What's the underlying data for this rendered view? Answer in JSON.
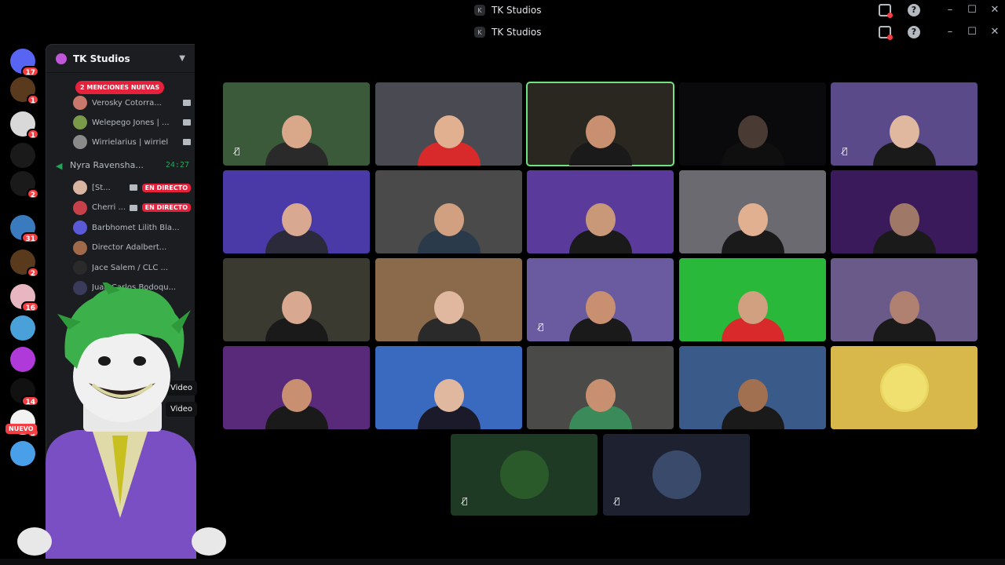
{
  "window": {
    "title": "TK Studios",
    "server_glyph": "K"
  },
  "rail": {
    "servers": [
      {
        "name": "discord-home",
        "badge": "17",
        "color": "#5865f2"
      },
      {
        "name": "server-2",
        "badge": "1",
        "color": "#5a3a1c"
      },
      {
        "name": "server-3",
        "badge": "1",
        "color": "#d9d9d9"
      },
      {
        "name": "server-tk",
        "badge": "",
        "color": "#1a1a1a"
      },
      {
        "name": "server-5",
        "badge": "2",
        "color": "#1a1a1a"
      },
      {
        "name": "server-6",
        "badge": "31",
        "color": "#3a7bbf"
      },
      {
        "name": "server-7",
        "badge": "2",
        "color": "#5a3a1c"
      },
      {
        "name": "server-8",
        "badge": "16",
        "color": "#e8b6c0"
      },
      {
        "name": "server-9",
        "badge": "",
        "color": "#4aa0d8"
      },
      {
        "name": "server-10",
        "badge": "",
        "color": "#b03ad9"
      },
      {
        "name": "server-11",
        "badge": "14",
        "color": "#111"
      },
      {
        "name": "server-12",
        "badge": "5",
        "color": "#f2f2f2"
      },
      {
        "name": "server-13",
        "badge": "",
        "color": "#4aa0e8"
      }
    ],
    "nuevo_label": "NUEVO"
  },
  "panel": {
    "server_name": "TK Studios",
    "mentions_label": "2 MENCIONES NUEVAS",
    "voice_channel": {
      "name": "Nyra Ravensha...",
      "timer": "24:27"
    },
    "users_top": [
      {
        "name": "Verosky Cotorra...",
        "color": "#c8786a"
      },
      {
        "name": "Welepego Jones | ...",
        "color": "#7a9a4a"
      },
      {
        "name": "Wirrielarius | wirriel",
        "color": "#8a8a8a"
      }
    ],
    "users_voice": [
      {
        "name": "[St...",
        "color": "#d9b4a0",
        "live": "EN DIRECTO"
      },
      {
        "name": "Cherri ...",
        "color": "#c8404a",
        "live": "EN DIRECTO"
      },
      {
        "name": "Barbhomet Lilith Bla...",
        "color": "#5a5ad8",
        "live": ""
      },
      {
        "name": "Director Adalbert...",
        "color": "#a06a4a",
        "live": ""
      },
      {
        "name": "Jace Salem / CLC ...",
        "color": "#2a2a2a",
        "live": ""
      },
      {
        "name": "Juan Carlos Bodoqu...",
        "color": "#3a3a5a",
        "live": ""
      }
    ],
    "tooltips": [
      "Video",
      "Video"
    ]
  },
  "grid": {
    "tiles": [
      {
        "bg": "#3a5a3a",
        "skin": "#d9a88a",
        "shirt": "#2a2a2a",
        "mute": true,
        "speaking": false
      },
      {
        "bg": "#4a4a52",
        "skin": "#e0b090",
        "shirt": "#d82a2a",
        "mute": false,
        "speaking": false
      },
      {
        "bg": "#2a2620",
        "skin": "#c89070",
        "shirt": "#1a1a1a",
        "mute": false,
        "speaking": true
      },
      {
        "bg": "#0a0a0c",
        "skin": "#4a3a34",
        "shirt": "#0f0f0f",
        "mute": false,
        "speaking": false
      },
      {
        "bg": "#5a4a8a",
        "skin": "#e0b8a0",
        "shirt": "#1a1a1a",
        "mute": true,
        "speaking": false
      },
      {
        "bg": "#4a3aa8",
        "skin": "#d8a890",
        "shirt": "#2a2a3a",
        "mute": false,
        "speaking": false
      },
      {
        "bg": "#4a4a4a",
        "skin": "#d0a080",
        "shirt": "#2a3a4a",
        "mute": false,
        "speaking": false
      },
      {
        "bg": "#5a3a9a",
        "skin": "#c89878",
        "shirt": "#1a1a1a",
        "mute": false,
        "speaking": false
      },
      {
        "bg": "#6a6a70",
        "skin": "#e0b090",
        "shirt": "#1a1a1a",
        "mute": false,
        "speaking": false
      },
      {
        "bg": "#3a1a5a",
        "skin": "#a07868",
        "shirt": "#1a1a1a",
        "mute": false,
        "speaking": false
      },
      {
        "bg": "#3a3a30",
        "skin": "#d8a890",
        "shirt": "#1a1a1a",
        "mute": false,
        "speaking": false
      },
      {
        "bg": "#8a6a4a",
        "skin": "#e0b8a0",
        "shirt": "#2a2a2a",
        "mute": false,
        "speaking": false
      },
      {
        "bg": "#6a5aa0",
        "skin": "#c89070",
        "shirt": "#1a1a1a",
        "mute": true,
        "speaking": false
      },
      {
        "bg": "#2ab83a",
        "skin": "#d0a080",
        "shirt": "#d82a2a",
        "mute": false,
        "speaking": false
      },
      {
        "bg": "#6a5a8a",
        "skin": "#b08070",
        "shirt": "#1a1a1a",
        "mute": false,
        "speaking": false
      },
      {
        "bg": "#5a2a7a",
        "skin": "#c89070",
        "shirt": "#1a1a1a",
        "mute": false,
        "speaking": false
      },
      {
        "bg": "#3a6ac0",
        "skin": "#e0b8a0",
        "shirt": "#1a1a2a",
        "mute": false,
        "speaking": false
      },
      {
        "bg": "#4a4a48",
        "skin": "#c89070",
        "shirt": "#3a8a5a",
        "mute": false,
        "speaking": false
      },
      {
        "bg": "#3a5a8a",
        "skin": "#a07050",
        "shirt": "#1a1a1a",
        "mute": false,
        "speaking": false
      },
      {
        "bg": "#d8b84a",
        "skin": "#f0e070",
        "shirt": "#d8b84a",
        "mute": false,
        "speaking": false,
        "avatar": true
      }
    ],
    "bottom_tiles": [
      {
        "bg": "#1e3a24",
        "avatar_color": "#2a5a2a",
        "mute": true
      },
      {
        "bg": "#1e2230",
        "avatar_color": "#3a4a6a",
        "mute": true
      }
    ]
  },
  "colors": {
    "accent_green": "#6ee37f",
    "live_red": "#e6213b",
    "panel_bg": "#1c1d21"
  }
}
